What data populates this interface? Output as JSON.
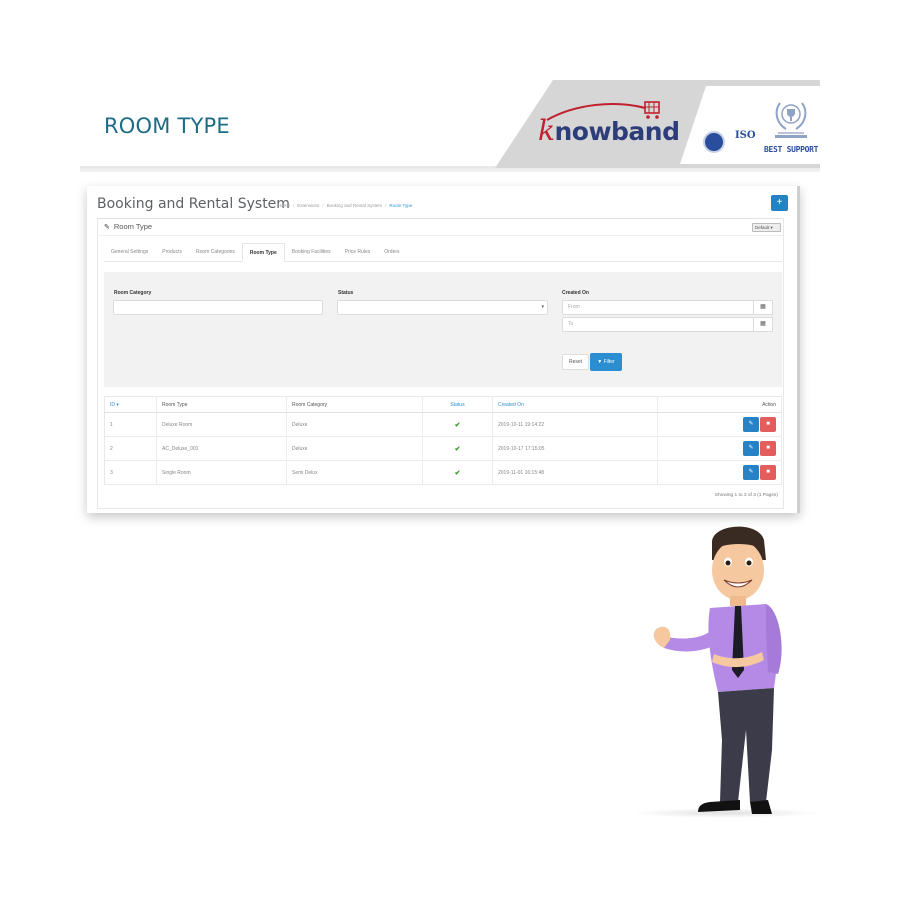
{
  "banner": {
    "title": "ROOM TYPE",
    "brand_logo_text": "nowband",
    "brand_logo_initial": "k",
    "iso_label": "ISO",
    "support_label": "BEST SUPPORT"
  },
  "admin": {
    "page_title": "Booking and Rental System",
    "breadcrumb": [
      "Home",
      "Extensions",
      "Booking and Rental System",
      "Room Type"
    ],
    "add_button_label": "+",
    "panel_title": "Room Type",
    "language_select": "Default",
    "tabs": [
      {
        "label": "General Settings",
        "active": false
      },
      {
        "label": "Products",
        "active": false
      },
      {
        "label": "Room Categories",
        "active": false
      },
      {
        "label": "Room Type",
        "active": true
      },
      {
        "label": "Booking Facilities",
        "active": false
      },
      {
        "label": "Price Rules",
        "active": false
      },
      {
        "label": "Orders",
        "active": false
      }
    ],
    "filter": {
      "room_category_label": "Room Category",
      "room_category_value": "",
      "status_label": "Status",
      "status_value": "",
      "created_on_label": "Created On",
      "from_placeholder": "From",
      "to_placeholder": "To",
      "reset_label": "Reset",
      "filter_label": "Filter"
    },
    "table": {
      "columns": [
        "ID",
        "Room Type",
        "Room Category",
        "Status",
        "Created On",
        "Action"
      ],
      "rows": [
        {
          "id": "1",
          "room_type": "Deluxe Room",
          "room_category": "Deluxe",
          "status": "enabled",
          "created_on": "2019-10-11 19:14:22"
        },
        {
          "id": "2",
          "room_type": "AC_Deluxe_001",
          "room_category": "Deluxe",
          "status": "enabled",
          "created_on": "2019-10-17 17:15:05"
        },
        {
          "id": "3",
          "room_type": "Single Room",
          "room_category": "Semi Delux",
          "status": "enabled",
          "created_on": "2019-11-01 16:15:48"
        }
      ],
      "pagination_text": "Showing 1 to 3 of 3 (1 Pages)"
    }
  },
  "colors": {
    "banner_title": "#1e6b86",
    "primary_button": "#2582c4",
    "delete_button": "#e55c5c",
    "status_ok": "#3a9b2e",
    "brand_red": "#c0212f",
    "brand_navy": "#2d3d7a"
  }
}
